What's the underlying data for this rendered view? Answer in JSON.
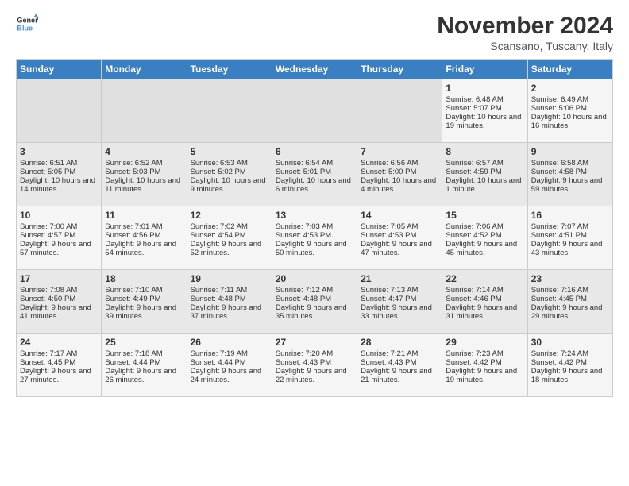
{
  "logo": {
    "line1": "General",
    "line2": "Blue"
  },
  "title": "November 2024",
  "location": "Scansano, Tuscany, Italy",
  "days_header": [
    "Sunday",
    "Monday",
    "Tuesday",
    "Wednesday",
    "Thursday",
    "Friday",
    "Saturday"
  ],
  "weeks": [
    [
      {
        "day": "",
        "info": ""
      },
      {
        "day": "",
        "info": ""
      },
      {
        "day": "",
        "info": ""
      },
      {
        "day": "",
        "info": ""
      },
      {
        "day": "",
        "info": ""
      },
      {
        "day": "1",
        "info": "Sunrise: 6:48 AM\nSunset: 5:07 PM\nDaylight: 10 hours and 19 minutes."
      },
      {
        "day": "2",
        "info": "Sunrise: 6:49 AM\nSunset: 5:06 PM\nDaylight: 10 hours and 16 minutes."
      }
    ],
    [
      {
        "day": "3",
        "info": "Sunrise: 6:51 AM\nSunset: 5:05 PM\nDaylight: 10 hours and 14 minutes."
      },
      {
        "day": "4",
        "info": "Sunrise: 6:52 AM\nSunset: 5:03 PM\nDaylight: 10 hours and 11 minutes."
      },
      {
        "day": "5",
        "info": "Sunrise: 6:53 AM\nSunset: 5:02 PM\nDaylight: 10 hours and 9 minutes."
      },
      {
        "day": "6",
        "info": "Sunrise: 6:54 AM\nSunset: 5:01 PM\nDaylight: 10 hours and 6 minutes."
      },
      {
        "day": "7",
        "info": "Sunrise: 6:56 AM\nSunset: 5:00 PM\nDaylight: 10 hours and 4 minutes."
      },
      {
        "day": "8",
        "info": "Sunrise: 6:57 AM\nSunset: 4:59 PM\nDaylight: 10 hours and 1 minute."
      },
      {
        "day": "9",
        "info": "Sunrise: 6:58 AM\nSunset: 4:58 PM\nDaylight: 9 hours and 59 minutes."
      }
    ],
    [
      {
        "day": "10",
        "info": "Sunrise: 7:00 AM\nSunset: 4:57 PM\nDaylight: 9 hours and 57 minutes."
      },
      {
        "day": "11",
        "info": "Sunrise: 7:01 AM\nSunset: 4:56 PM\nDaylight: 9 hours and 54 minutes."
      },
      {
        "day": "12",
        "info": "Sunrise: 7:02 AM\nSunset: 4:54 PM\nDaylight: 9 hours and 52 minutes."
      },
      {
        "day": "13",
        "info": "Sunrise: 7:03 AM\nSunset: 4:53 PM\nDaylight: 9 hours and 50 minutes."
      },
      {
        "day": "14",
        "info": "Sunrise: 7:05 AM\nSunset: 4:53 PM\nDaylight: 9 hours and 47 minutes."
      },
      {
        "day": "15",
        "info": "Sunrise: 7:06 AM\nSunset: 4:52 PM\nDaylight: 9 hours and 45 minutes."
      },
      {
        "day": "16",
        "info": "Sunrise: 7:07 AM\nSunset: 4:51 PM\nDaylight: 9 hours and 43 minutes."
      }
    ],
    [
      {
        "day": "17",
        "info": "Sunrise: 7:08 AM\nSunset: 4:50 PM\nDaylight: 9 hours and 41 minutes."
      },
      {
        "day": "18",
        "info": "Sunrise: 7:10 AM\nSunset: 4:49 PM\nDaylight: 9 hours and 39 minutes."
      },
      {
        "day": "19",
        "info": "Sunrise: 7:11 AM\nSunset: 4:48 PM\nDaylight: 9 hours and 37 minutes."
      },
      {
        "day": "20",
        "info": "Sunrise: 7:12 AM\nSunset: 4:48 PM\nDaylight: 9 hours and 35 minutes."
      },
      {
        "day": "21",
        "info": "Sunrise: 7:13 AM\nSunset: 4:47 PM\nDaylight: 9 hours and 33 minutes."
      },
      {
        "day": "22",
        "info": "Sunrise: 7:14 AM\nSunset: 4:46 PM\nDaylight: 9 hours and 31 minutes."
      },
      {
        "day": "23",
        "info": "Sunrise: 7:16 AM\nSunset: 4:45 PM\nDaylight: 9 hours and 29 minutes."
      }
    ],
    [
      {
        "day": "24",
        "info": "Sunrise: 7:17 AM\nSunset: 4:45 PM\nDaylight: 9 hours and 27 minutes."
      },
      {
        "day": "25",
        "info": "Sunrise: 7:18 AM\nSunset: 4:44 PM\nDaylight: 9 hours and 26 minutes."
      },
      {
        "day": "26",
        "info": "Sunrise: 7:19 AM\nSunset: 4:44 PM\nDaylight: 9 hours and 24 minutes."
      },
      {
        "day": "27",
        "info": "Sunrise: 7:20 AM\nSunset: 4:43 PM\nDaylight: 9 hours and 22 minutes."
      },
      {
        "day": "28",
        "info": "Sunrise: 7:21 AM\nSunset: 4:43 PM\nDaylight: 9 hours and 21 minutes."
      },
      {
        "day": "29",
        "info": "Sunrise: 7:23 AM\nSunset: 4:42 PM\nDaylight: 9 hours and 19 minutes."
      },
      {
        "day": "30",
        "info": "Sunrise: 7:24 AM\nSunset: 4:42 PM\nDaylight: 9 hours and 18 minutes."
      }
    ]
  ]
}
